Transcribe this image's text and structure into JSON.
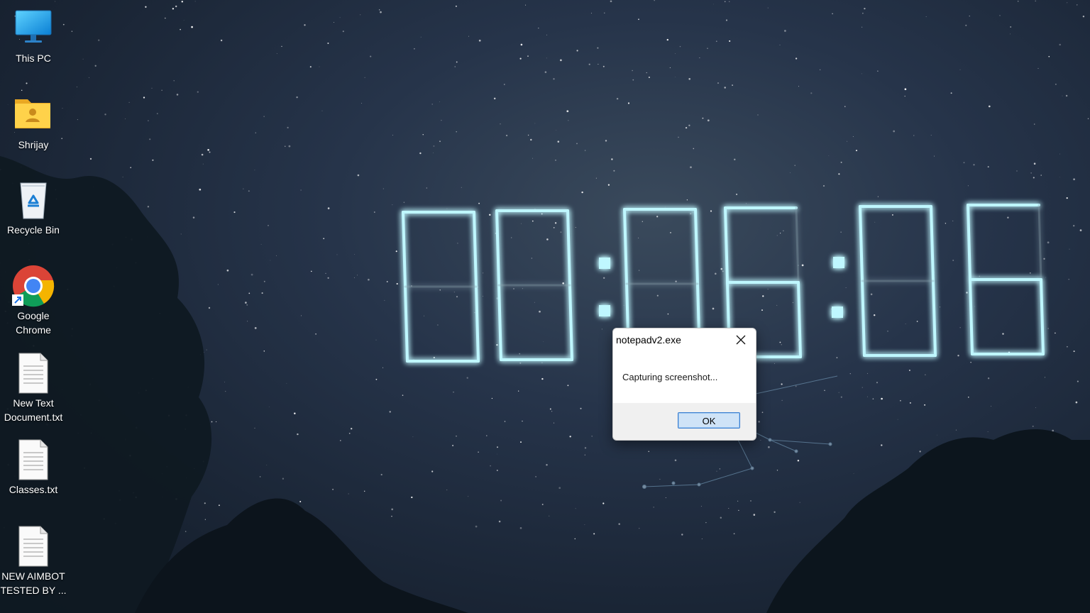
{
  "desktop": {
    "icons": [
      {
        "label": "This PC",
        "icon": "monitor-icon"
      },
      {
        "label": "Shrijay",
        "icon": "user-folder-icon"
      },
      {
        "label": "Recycle Bin",
        "icon": "recycle-bin-icon"
      },
      {
        "label": "Google Chrome",
        "icon": "chrome-icon"
      },
      {
        "label": "New Text Document.txt",
        "icon": "text-file-icon"
      },
      {
        "label": "Classes.txt",
        "icon": "text-file-icon"
      },
      {
        "label": "NEW AIMBOT TESTED BY ...",
        "icon": "text-file-icon"
      }
    ]
  },
  "clock": {
    "time": "00:06:06",
    "color": "#bff7ff"
  },
  "dialog": {
    "title": "notepadv2.exe",
    "message": "Capturing screenshot...",
    "ok_label": "OK"
  }
}
